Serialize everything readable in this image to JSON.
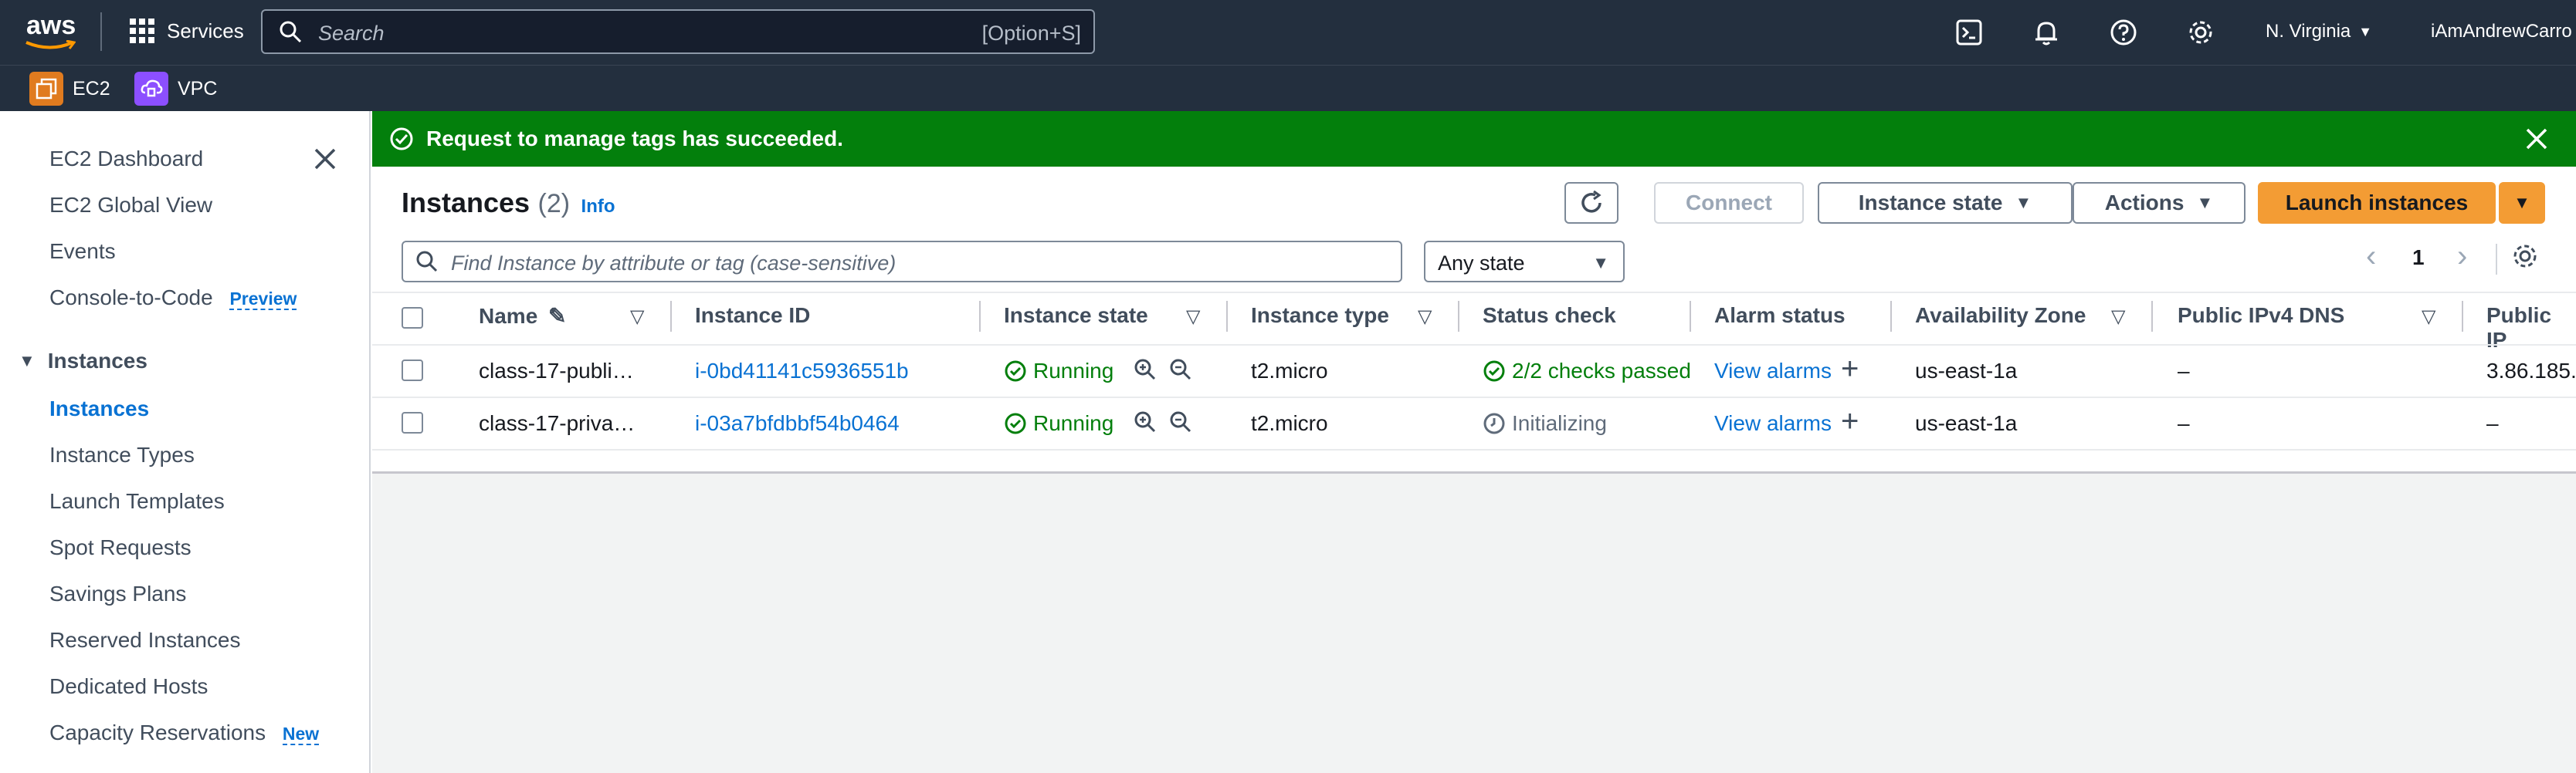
{
  "topnav": {
    "logo": "aws",
    "services_label": "Services",
    "search_placeholder": "Search",
    "search_shortcut": "[Option+S]",
    "region": "N. Virginia",
    "account": "iAmAndrewCarro"
  },
  "favorites": [
    {
      "label": "EC2",
      "color": "#e07b1f"
    },
    {
      "label": "VPC",
      "color": "#8c4fff"
    }
  ],
  "sidebar": {
    "items": [
      {
        "label": "EC2 Dashboard"
      },
      {
        "label": "EC2 Global View"
      },
      {
        "label": "Events"
      },
      {
        "label": "Console-to-Code",
        "badge": "Preview"
      }
    ],
    "section_title": "Instances",
    "section_items": [
      {
        "label": "Instances"
      },
      {
        "label": "Instance Types"
      },
      {
        "label": "Launch Templates"
      },
      {
        "label": "Spot Requests"
      },
      {
        "label": "Savings Plans"
      },
      {
        "label": "Reserved Instances"
      },
      {
        "label": "Dedicated Hosts"
      },
      {
        "label": "Capacity Reservations",
        "badge": "New"
      }
    ]
  },
  "flash": {
    "message": "Request to manage tags has succeeded.",
    "color": "#037f0c"
  },
  "header": {
    "title": "Instances",
    "count": "(2)",
    "info": "Info",
    "connect": "Connect",
    "instance_state": "Instance state",
    "actions": "Actions",
    "launch": "Launch instances"
  },
  "filter": {
    "placeholder": "Find Instance by attribute or tag (case-sensitive)",
    "state_select": "Any state",
    "page": "1"
  },
  "table": {
    "columns": [
      "Name",
      "Instance ID",
      "Instance state",
      "Instance type",
      "Status check",
      "Alarm status",
      "Availability Zone",
      "Public IPv4 DNS",
      "Public IP"
    ],
    "rows": [
      {
        "name": "class-17-publi…",
        "id": "i-0bd41141c5936551b",
        "state": "Running",
        "type": "t2.micro",
        "status": "2/2 checks passed",
        "alarm": "View alarms",
        "az": "us-east-1a",
        "dns": "–",
        "ip": "3.86.185."
      },
      {
        "name": "class-17-priva…",
        "id": "i-03a7bfdbbf54b0464",
        "state": "Running",
        "type": "t2.micro",
        "status": "Initializing",
        "alarm": "View alarms",
        "az": "us-east-1a",
        "dns": "–",
        "ip": "–"
      }
    ]
  }
}
